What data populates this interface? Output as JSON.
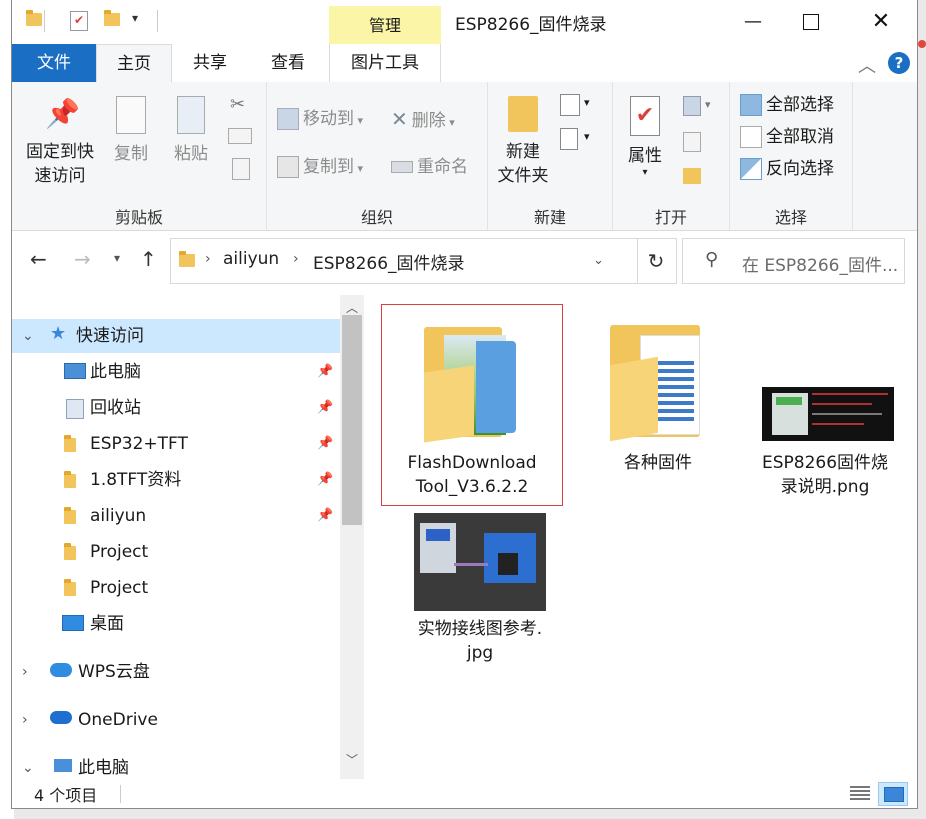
{
  "window": {
    "title": "ESP8266_固件烧录",
    "manage_tab": "管理"
  },
  "ribbon_tabs": [
    {
      "label": "文件"
    },
    {
      "label": "主页"
    },
    {
      "label": "共享"
    },
    {
      "label": "查看"
    },
    {
      "label": "图片工具"
    }
  ],
  "ribbon": {
    "clipboard": {
      "label": "剪贴板",
      "pin_label_1": "固定到快",
      "pin_label_2": "速访问",
      "copy": "复制",
      "paste": "粘贴"
    },
    "organize": {
      "label": "组织",
      "move_to": "移动到",
      "copy_to": "复制到",
      "delete": "删除",
      "rename": "重命名"
    },
    "new": {
      "label": "新建",
      "new_folder_1": "新建",
      "new_folder_2": "文件夹"
    },
    "open": {
      "label": "打开",
      "properties": "属性"
    },
    "select": {
      "label": "选择",
      "select_all": "全部选择",
      "select_none": "全部取消",
      "invert": "反向选择"
    }
  },
  "address": {
    "crumbs": [
      "ailiyun",
      "ESP8266_固件烧录"
    ],
    "search_placeholder": "在 ESP8266_固件..."
  },
  "nav": {
    "items": [
      {
        "label": "快速访问",
        "icon": "star-icon"
      },
      {
        "label": "此电脑",
        "icon": "computer-icon"
      },
      {
        "label": "回收站",
        "icon": "recycle-bin-icon"
      },
      {
        "label": "ESP32+TFT",
        "icon": "folder-icon"
      },
      {
        "label": "1.8TFT资料",
        "icon": "folder-icon"
      },
      {
        "label": "ailiyun",
        "icon": "folder-icon"
      },
      {
        "label": "Project",
        "icon": "folder-icon"
      },
      {
        "label": "Project",
        "icon": "folder-icon"
      },
      {
        "label": "桌面",
        "icon": "desktop-icon"
      },
      {
        "label": "WPS云盘",
        "icon": "cloud-icon"
      },
      {
        "label": "OneDrive",
        "icon": "onedrive-icon"
      },
      {
        "label": "此电脑",
        "icon": "computer-icon"
      }
    ]
  },
  "files": [
    {
      "name_1": "FlashDownload",
      "name_2": "Tool_V3.6.2.2",
      "type": "folder"
    },
    {
      "name_1": "各种固件",
      "name_2": "",
      "type": "folder"
    },
    {
      "name_1": "ESP8266固件烧",
      "name_2": "录说明.png",
      "type": "image"
    },
    {
      "name_1": "实物接线图参考.",
      "name_2": "jpg",
      "type": "image"
    }
  ],
  "status": {
    "item_count": "4 个项目"
  },
  "colors": {
    "file_tab": "#1a6fc4",
    "manage_tab": "#fbf5a7",
    "selected_nav": "#cce8ff",
    "selection_frame": "#d9413c",
    "folder": "#f2c55c"
  }
}
